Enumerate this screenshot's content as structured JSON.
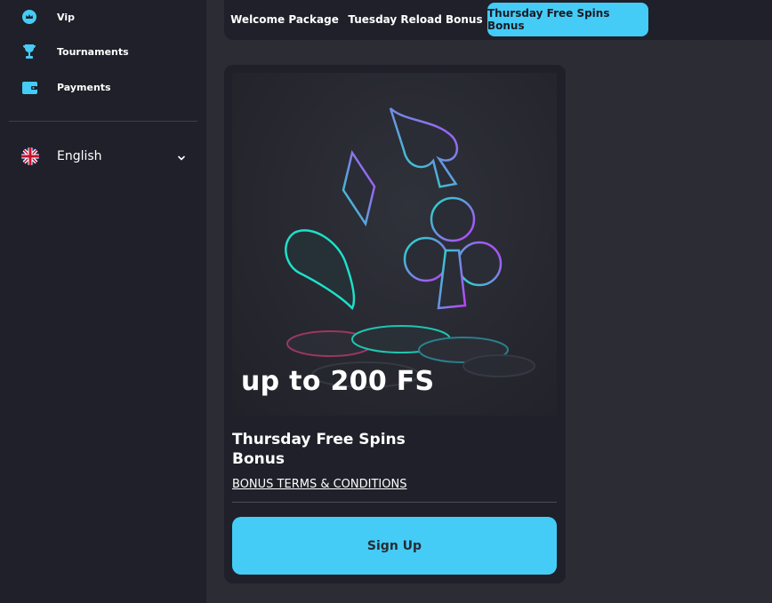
{
  "sidebar": {
    "items": [
      {
        "label": "Vip",
        "icon": "crown-icon"
      },
      {
        "label": "Tournaments",
        "icon": "trophy-icon"
      },
      {
        "label": "Payments",
        "icon": "wallet-icon"
      }
    ],
    "language": {
      "label": "English",
      "icon": "uk-flag-icon"
    }
  },
  "tabs": [
    {
      "label": "Welcome Package",
      "active": false
    },
    {
      "label": "Tuesday Reload Bonus",
      "active": false
    },
    {
      "label": "Thursday Free Spins Bonus",
      "active": true
    }
  ],
  "bonus_card": {
    "banner_text": "up to 200 FS",
    "title": "Thursday Free Spins Bonus",
    "terms_link": "BONUS TERMS & CONDITIONS",
    "cta_label": "Sign Up"
  },
  "colors": {
    "accent": "#44ccf7",
    "sidebar_bg": "#1f2029",
    "page_bg": "#2b2c34"
  }
}
